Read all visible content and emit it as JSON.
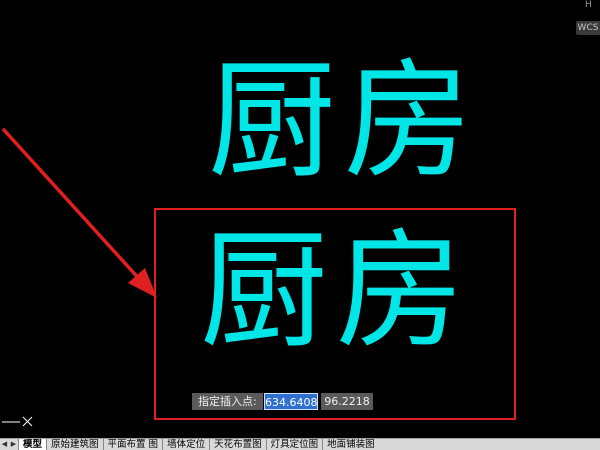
{
  "canvas": {
    "background": "#000000",
    "text_color": "#00e5e5",
    "text_upper": "厨房",
    "text_lower": "厨房",
    "highlight_color": "#e02020",
    "arrow_color": "#e02020"
  },
  "viewcube": {
    "wcs_label": "WCS",
    "corner_letter": "H"
  },
  "coordinate_input": {
    "prompt": "指定插入点:",
    "x_value": "634.6408",
    "y_value": "96.2218"
  },
  "tabbar": {
    "nav_prev": "◀",
    "nav_next": "▶",
    "tabs": [
      {
        "label": "模型",
        "active": true
      },
      {
        "label": "原始建筑图",
        "active": false
      },
      {
        "label": "平面布置 图",
        "active": false
      },
      {
        "label": "墙体定位",
        "active": false
      },
      {
        "label": "天花布置图",
        "active": false
      },
      {
        "label": "灯具定位图",
        "active": false
      },
      {
        "label": "地面铺装图",
        "active": false
      }
    ]
  }
}
